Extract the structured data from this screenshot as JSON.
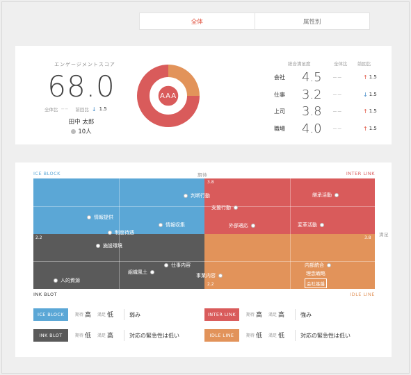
{
  "tabs": [
    {
      "label": "全体",
      "active": true
    },
    {
      "label": "属性別",
      "active": false
    }
  ],
  "score": {
    "title": "エンゲージメントスコア",
    "value": "68.0",
    "overall_label": "全体比",
    "overall_value": "−−",
    "prev_label": "前回比",
    "prev_value": "1.5",
    "prev_direction": "down",
    "person": "田中 太郎",
    "count": "10人",
    "rank": "AAA"
  },
  "metrics": {
    "head_satisfaction": "総合満足度",
    "head_overall": "全体比",
    "head_prev": "前回比",
    "rows": [
      {
        "name": "会社",
        "value": "4.5",
        "overall": "−−",
        "delta": "1.5",
        "direction": "up"
      },
      {
        "name": "仕事",
        "value": "3.2",
        "overall": "−−",
        "delta": "1.5",
        "direction": "down"
      },
      {
        "name": "上司",
        "value": "3.8",
        "overall": "−−",
        "delta": "1.5",
        "direction": "up"
      },
      {
        "name": "職場",
        "value": "4.0",
        "overall": "−−",
        "delta": "1.5",
        "direction": "up"
      }
    ]
  },
  "matrix": {
    "corner_tl": "ICE BLOCK",
    "corner_tr": "INTER LINK",
    "corner_bl": "INK BLOT",
    "corner_br": "IDLE LINE",
    "top_axis": "期待",
    "right_axis": "満足",
    "num_top": "3.8",
    "num_left": "2.2",
    "num_right": "3.8",
    "num_bottom": "2.2",
    "points": {
      "p1": "判断行動",
      "p2": "支援行動",
      "p3": "継承活動",
      "p4": "情報提供",
      "p5": "情報収集",
      "p6": "外部適応",
      "p7": "変革活動",
      "p8": "制度待遇",
      "p9": "施設環境",
      "p10": "仕事内容",
      "p11": "組織風土",
      "p12": "人的資源",
      "p13": "事業内容",
      "p14": "内部統合",
      "p15": "理念戦略",
      "p16": "会社基盤"
    }
  },
  "legend": {
    "expect_label": "期待",
    "satisfy_label": "満足",
    "high": "高",
    "low": "低",
    "items": [
      {
        "name": "ICE BLOCK",
        "expect": "高",
        "satisfy": "低",
        "desc": "弱み"
      },
      {
        "name": "INTER LINK",
        "expect": "高",
        "satisfy": "高",
        "desc": "強み"
      },
      {
        "name": "INK BLOT",
        "expect": "低",
        "satisfy": "高",
        "desc": "対応の緊急性は低い"
      },
      {
        "name": "IDLE LINE",
        "expect": "低",
        "satisfy": "低",
        "desc": "対応の緊急性は低い"
      }
    ]
  },
  "colors": {
    "blue": "#5ba7d6",
    "red": "#d95b5b",
    "gray": "#5a5a5a",
    "orange": "#e2935a",
    "accent": "#e0513d"
  }
}
